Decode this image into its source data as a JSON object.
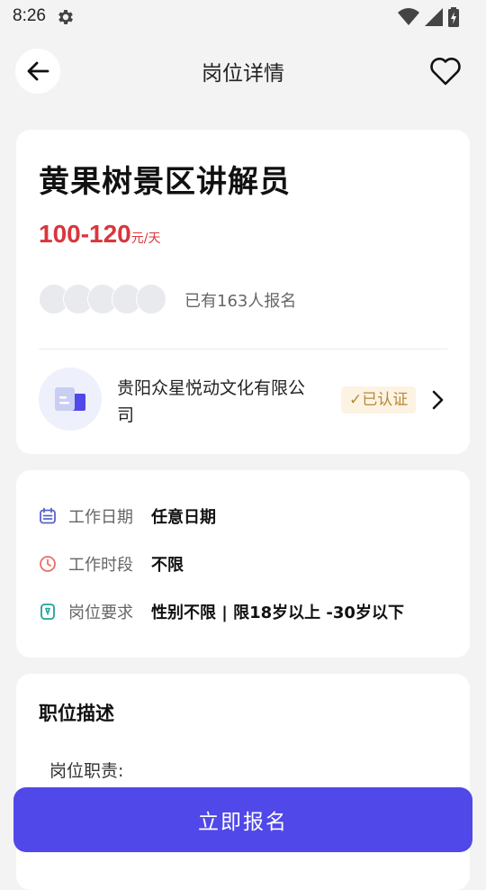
{
  "status_bar": {
    "time": "8:26"
  },
  "header": {
    "title": "岗位详情"
  },
  "job": {
    "title": "黄果树景区讲解员",
    "salary_amount": "100-120",
    "salary_unit": "元/天",
    "signup_text": "已有163人报名"
  },
  "company": {
    "name": "贵阳众星悦动文化有限公司",
    "verified_label": "✓已认证"
  },
  "info": [
    {
      "icon": "calendar-icon",
      "label": "工作日期",
      "value": "任意日期"
    },
    {
      "icon": "clock-icon",
      "label": "工作时段",
      "value": "不限"
    },
    {
      "icon": "requirement-icon",
      "label": "岗位要求",
      "value": "性别不限 | 限18岁以上 -30岁以下"
    }
  ],
  "description": {
    "title": "职位描述",
    "duty_label": "岗位职责:"
  },
  "cta": {
    "label": "立即报名"
  },
  "colors": {
    "accent": "#5048e8",
    "salary": "#d9363e",
    "verified_bg": "#fdf3e3",
    "verified_text": "#b8873b",
    "background": "#f3f3f3"
  }
}
